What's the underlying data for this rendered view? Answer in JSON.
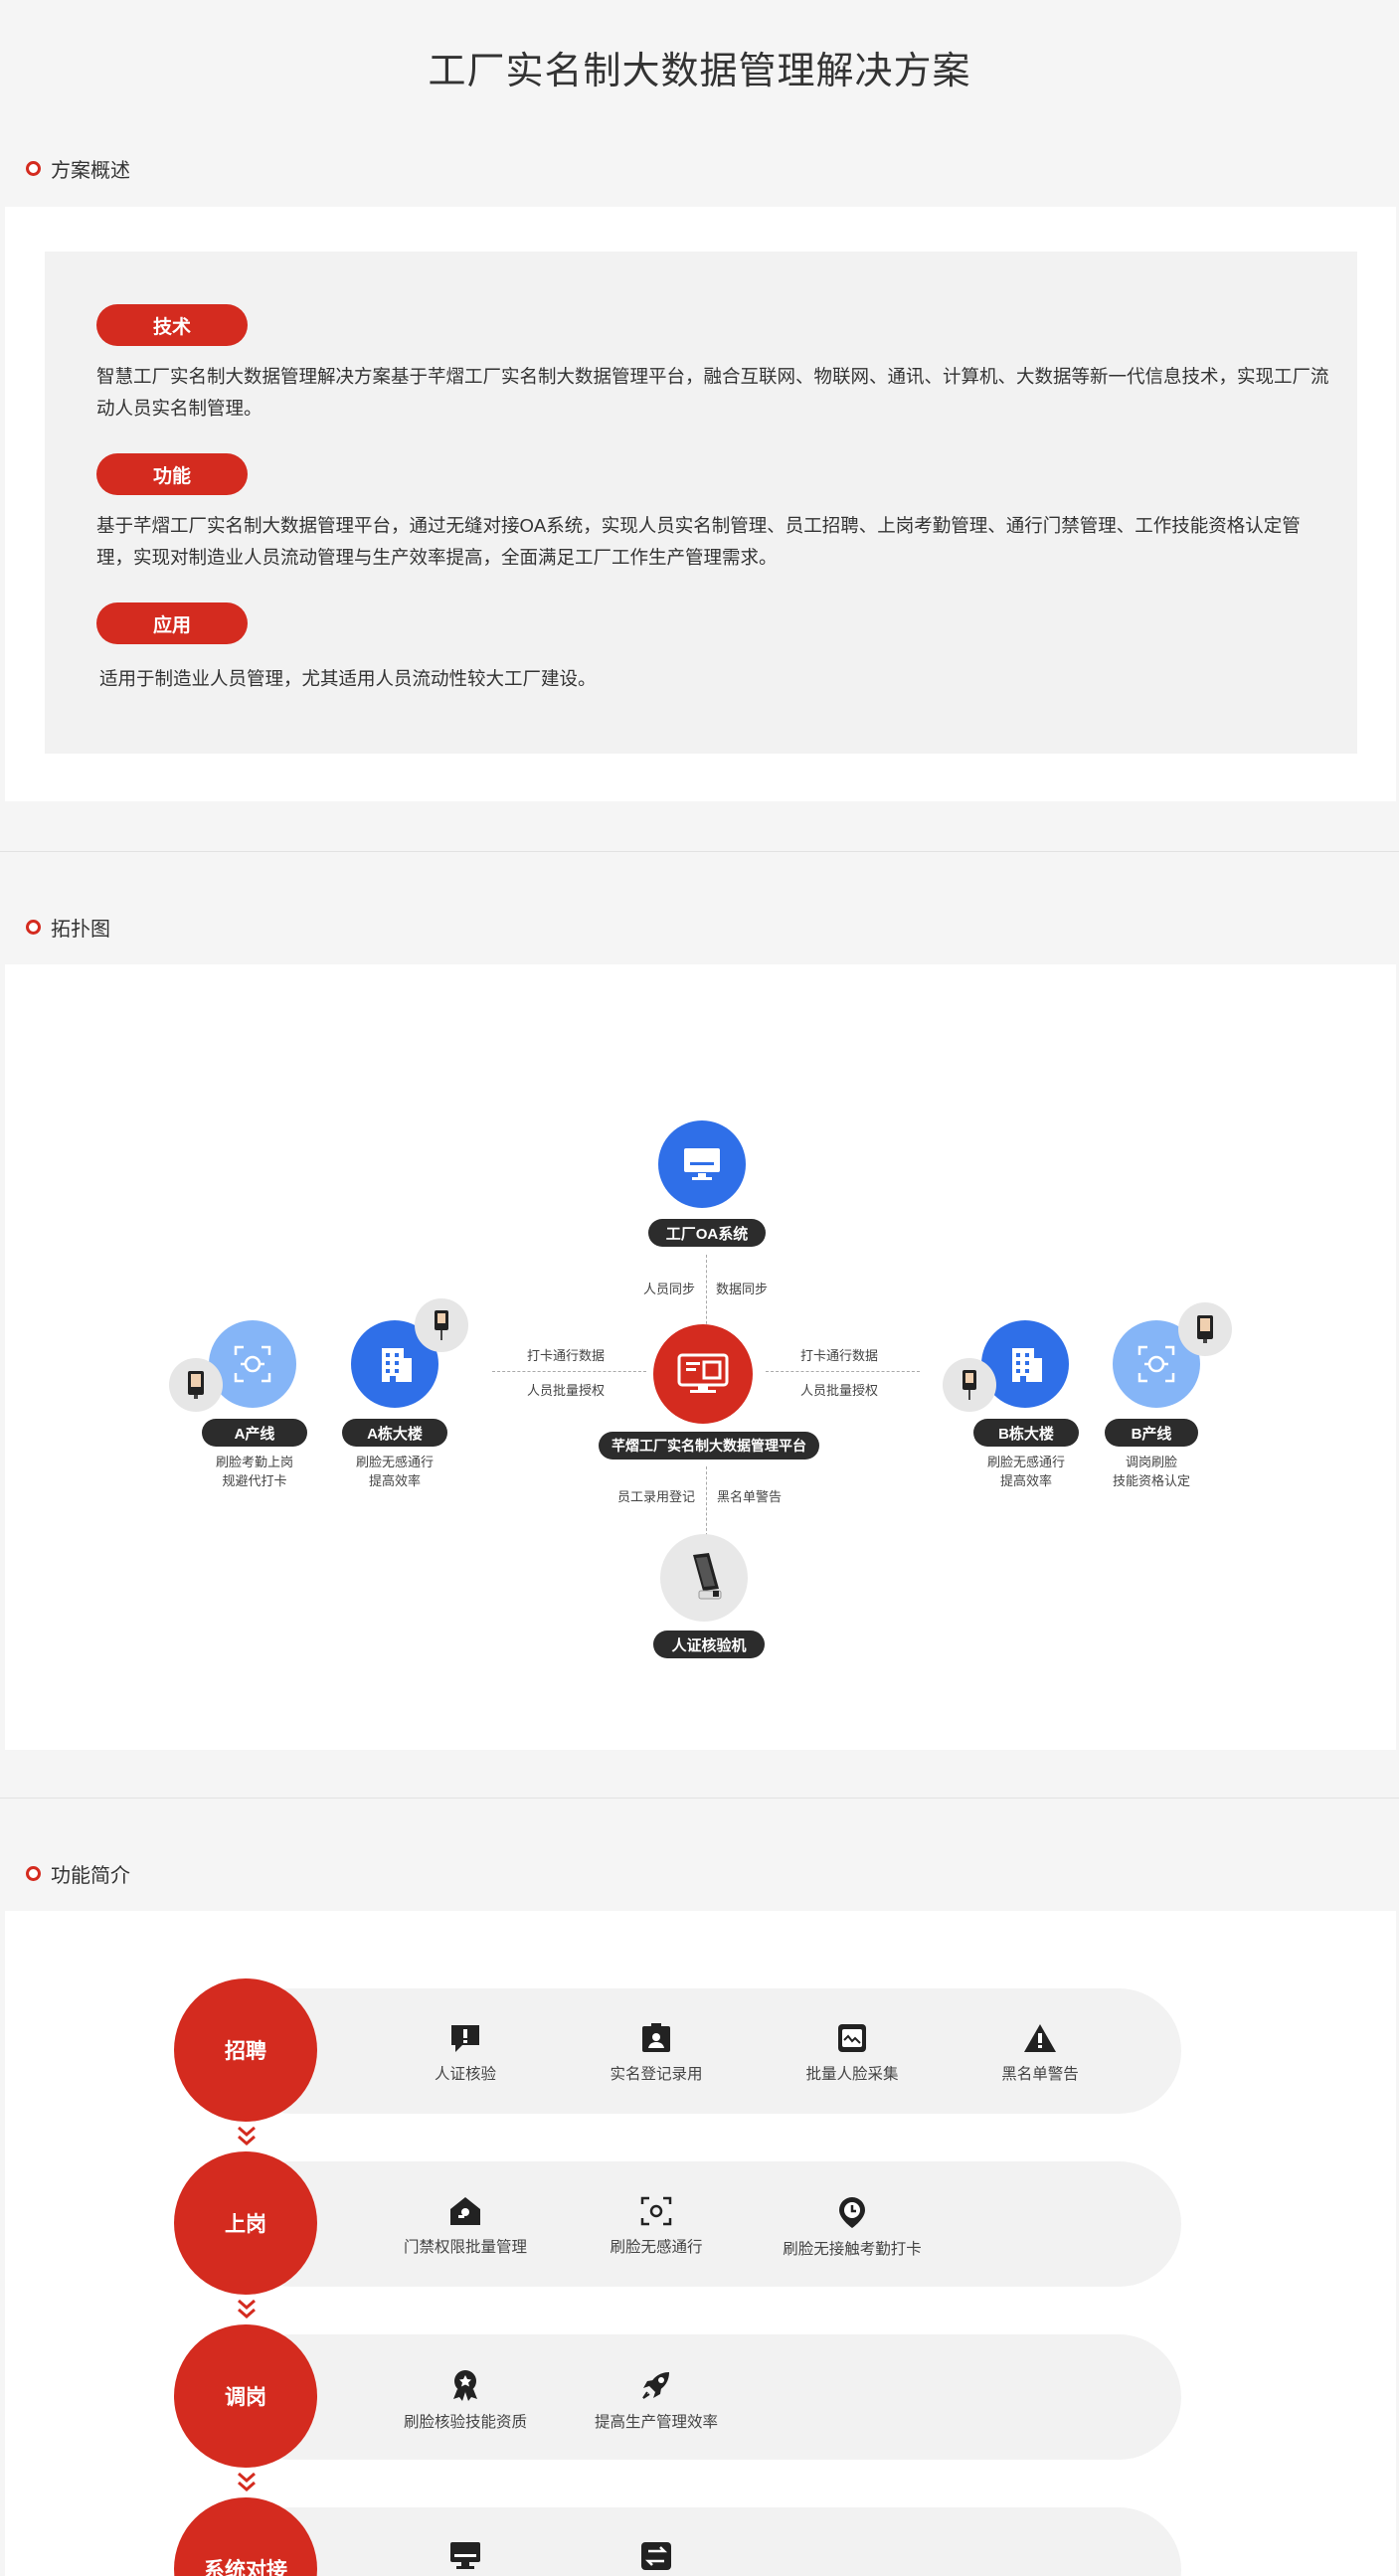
{
  "title": "工厂实名制大数据管理解决方案",
  "sections": {
    "overview": "方案概述",
    "topology": "拓扑图",
    "features": "功能简介"
  },
  "overview": {
    "tech_label": "技术",
    "tech_text": "智慧工厂实名制大数据管理解决方案基于芊熠工厂实名制大数据管理平台，融合互联网、物联网、通讯、计算机、大数据等新一代信息技术，实现工厂流动人员实名制管理。",
    "func_label": "功能",
    "func_text": "基于芊熠工厂实名制大数据管理平台，通过无缝对接OA系统，实现人员实名制管理、员工招聘、上岗考勤管理、通行门禁管理、工作技能资格认定管理，实现对制造业人员流动管理与生产效率提高，全面满足工厂工作生产管理需求。",
    "app_label": "应用",
    "app_text": "适用于制造业人员管理，尤其适用人员流动性较大工厂建设。"
  },
  "topology": {
    "oa": "工厂OA系统",
    "oa_left": "人员同步",
    "oa_right": "数据同步",
    "platform": "芊熠工厂实名制大数据管理平台",
    "left_top": "打卡通行数据",
    "left_bottom": "人员批量授权",
    "right_top": "打卡通行数据",
    "right_bottom": "人员批量授权",
    "bottom_left": "员工录用登记",
    "bottom_right": "黑名单警告",
    "device": "人证核验机",
    "a_line": "A产线",
    "a_line_desc1": "刷脸考勤上岗",
    "a_line_desc2": "规避代打卡",
    "a_building": "A栋大楼",
    "a_building_desc1": "刷脸无感通行",
    "a_building_desc2": "提高效率",
    "b_building": "B栋大楼",
    "b_building_desc1": "刷脸无感通行",
    "b_building_desc2": "提高效率",
    "b_line": "B产线",
    "b_line_desc1": "调岗刷脸",
    "b_line_desc2": "技能资格认定"
  },
  "features": [
    {
      "stage": "招聘",
      "items": [
        "人证核验",
        "实名登记录用",
        "批量人脸采集",
        "黑名单警告"
      ]
    },
    {
      "stage": "上岗",
      "items": [
        "门禁权限批量管理",
        "刷脸无感通行",
        "刷脸无接触考勤打卡"
      ]
    },
    {
      "stage": "调岗",
      "items": [
        "刷脸核验技能资质",
        "提高生产管理效率"
      ]
    },
    {
      "stage": "系统对接",
      "items": []
    }
  ],
  "colors": {
    "accent": "#d42b1f",
    "blue": "#2f6fe8",
    "light_blue": "#85b5f7",
    "dark_tag": "#2c2c2c"
  }
}
